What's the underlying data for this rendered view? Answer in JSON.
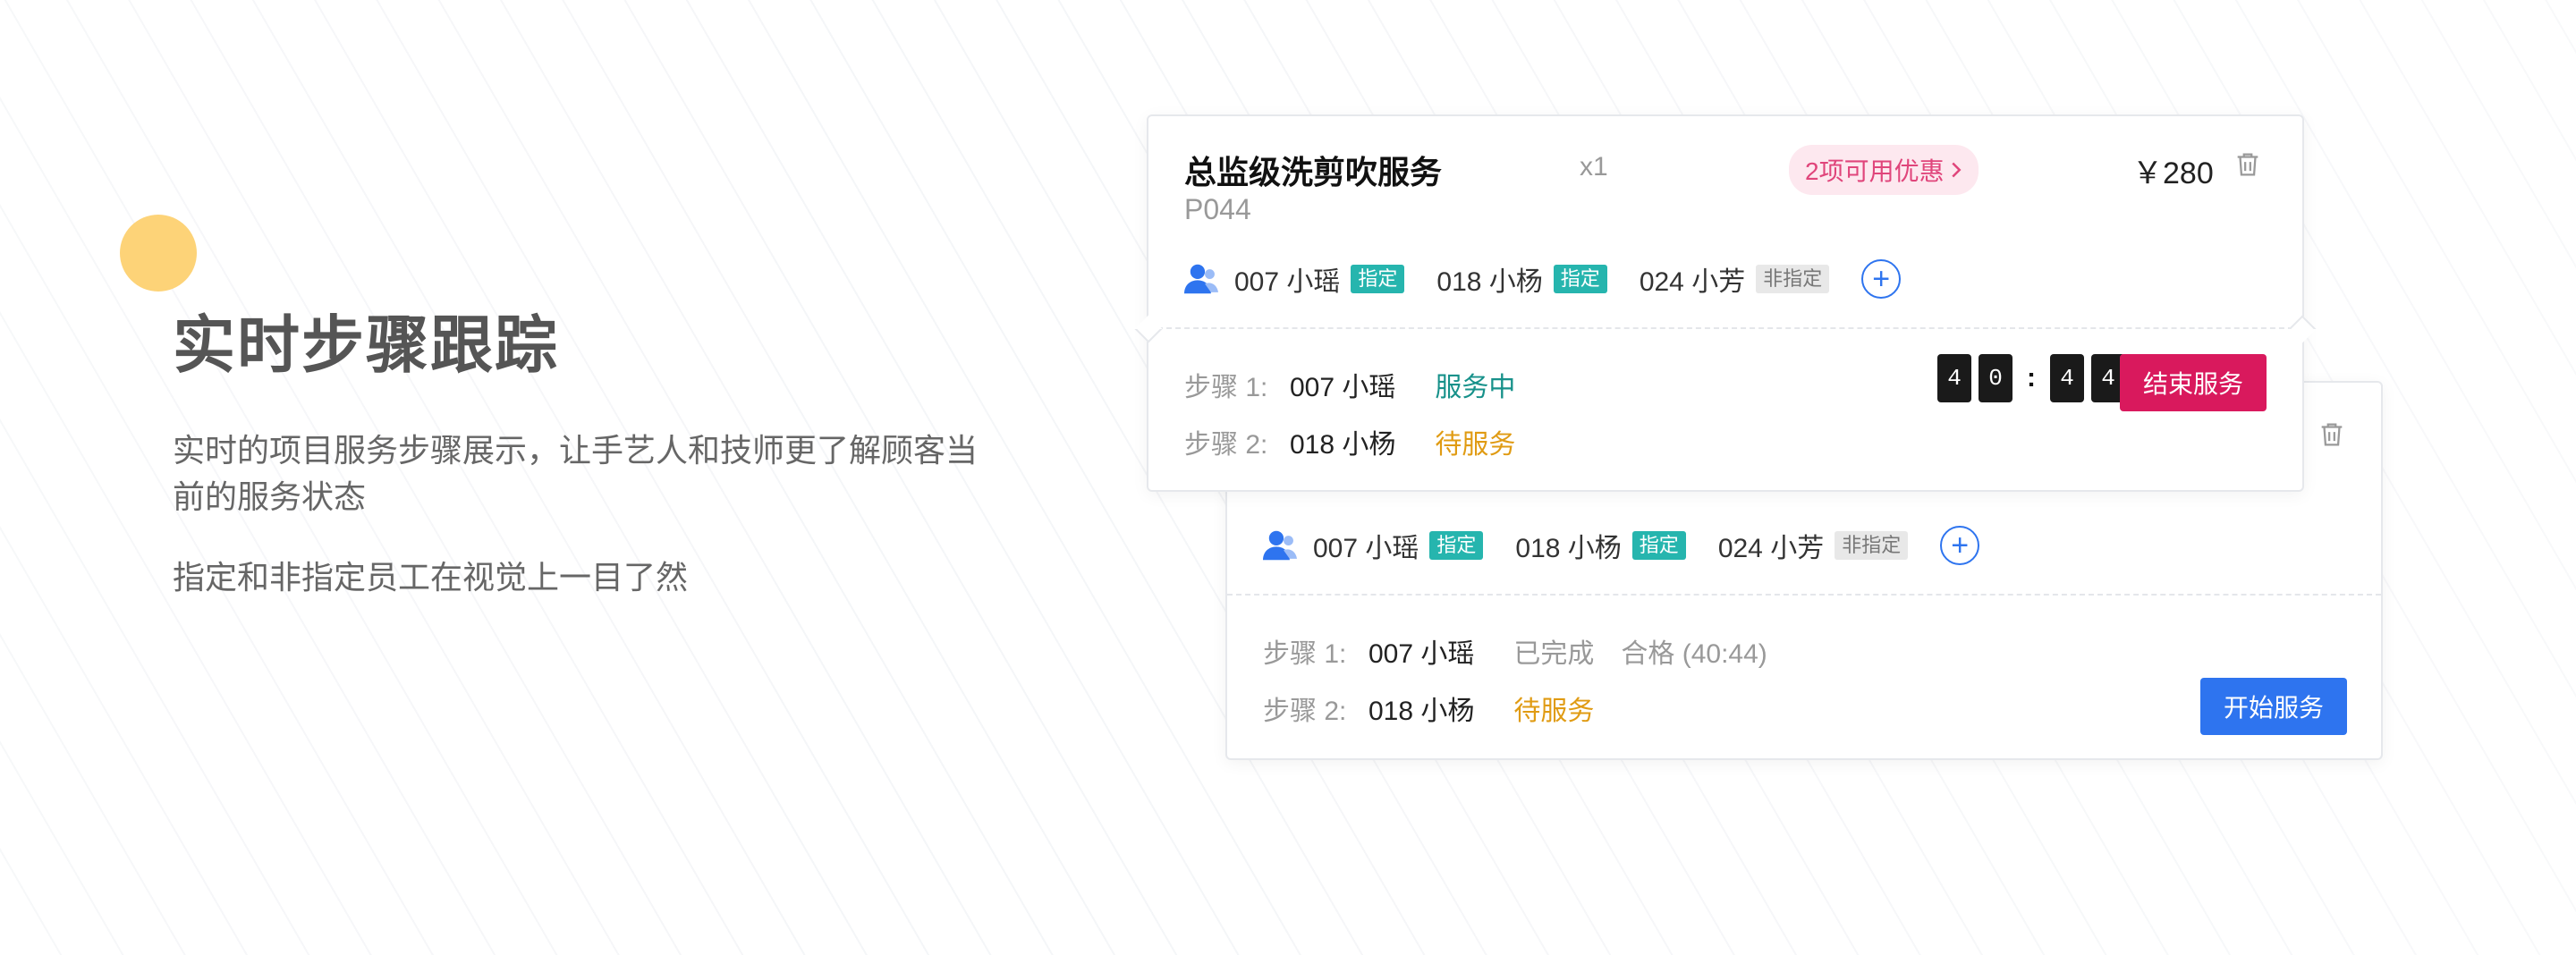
{
  "intro": {
    "title": "实时步骤跟踪",
    "desc1": "实时的项目服务步骤展示，让手艺人和技师更了解顾客当前的服务状态",
    "desc2": "指定和非指定员工在视觉上一目了然"
  },
  "front_card": {
    "service_name": "总监级洗剪吹服务",
    "service_code": "P044",
    "qty": "x1",
    "coupon": "2项可用优惠",
    "price": "￥280",
    "staff": [
      {
        "name": "007 小瑶",
        "tag": "指定",
        "assigned": true
      },
      {
        "name": "018 小杨",
        "tag": "指定",
        "assigned": true
      },
      {
        "name": "024 小芳",
        "tag": "非指定",
        "assigned": false
      }
    ],
    "add_label": "+",
    "steps": [
      {
        "label": "步骤 1:",
        "person": "007 小瑶",
        "status": "服务中"
      },
      {
        "label": "步骤 2:",
        "person": "018 小杨",
        "status": "待服务"
      }
    ],
    "timer": {
      "d1": "4",
      "d2": "0",
      "sep": ":",
      "d3": "4",
      "d4": "4"
    },
    "end_button": "结束服务"
  },
  "back_card": {
    "staff": [
      {
        "name": "007 小瑶",
        "tag": "指定",
        "assigned": true
      },
      {
        "name": "018 小杨",
        "tag": "指定",
        "assigned": true
      },
      {
        "name": "024 小芳",
        "tag": "非指定",
        "assigned": false
      }
    ],
    "add_label": "+",
    "steps": [
      {
        "label": "步骤 1:",
        "person": "007 小瑶",
        "status": "已完成",
        "result": "合格 (40:44)"
      },
      {
        "label": "步骤 2:",
        "person": "018 小杨",
        "status": "待服务"
      }
    ],
    "start_button": "开始服务"
  },
  "colors": {
    "accent_blue": "#2e74ef",
    "accent_teal": "#26b5ae",
    "end_red": "#d9195d",
    "waiting_orange": "#e09b13",
    "coupon_pink": "#e0457b",
    "dot_yellow": "#fdd378"
  },
  "icons": {
    "person": "person-icon",
    "trash": "trash-icon",
    "chevron": "chevron-right-icon",
    "add": "plus-circle-icon"
  }
}
